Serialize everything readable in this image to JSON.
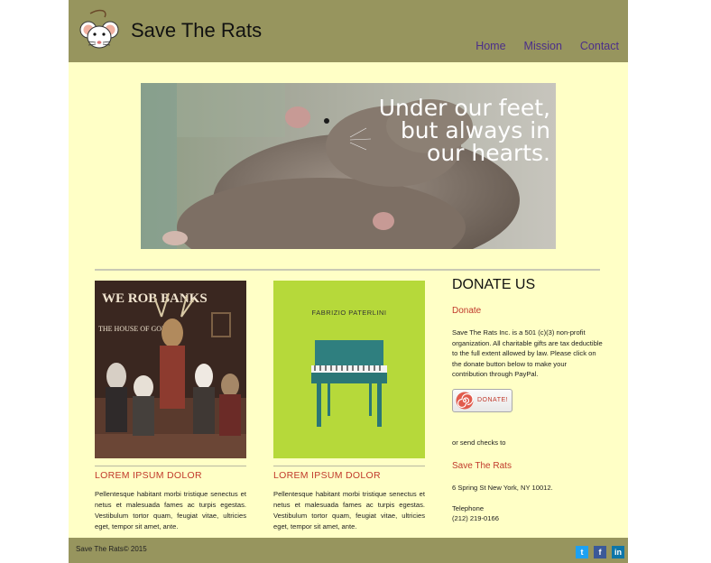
{
  "site": {
    "title": "Save The Rats"
  },
  "nav": {
    "items": [
      "Home",
      "Mission",
      "Contact"
    ]
  },
  "hero": {
    "lines": [
      "Under our feet,",
      "but always in",
      "our hearts."
    ]
  },
  "cards": [
    {
      "art_caption": "WE ROB BANKS",
      "art_sub": "THE HOUSE OF GONZO",
      "title": "LOREM IPSUM DOLOR",
      "text": "Pellentesque habitant morbi tristique senectus et netus et malesuada fames ac turpis egestas. Vestibulum tortor quam, feugiat vitae, ultricies eget, tempor sit amet, ante."
    },
    {
      "art_caption": "FABRIZIO PATERLINI",
      "title": "LOREM IPSUM DOLOR",
      "text": "Pellentesque habitant morbi tristique senectus et netus et malesuada fames ac turpis egestas. Vestibulum tortor quam, feugiat vitae, ultricies eget, tempor sit amet, ante."
    }
  ],
  "donate": {
    "heading": "DONATE US",
    "subheading": "Donate",
    "description": "Save The Rats Inc. is a 501 (c)(3) non-profit organization. All charitable gifts are tax deductible to the full extent allowed by law. Please click on the donate button below to make your contribution through PayPal.",
    "button_label": "DONATE!",
    "checks_text": "or send checks to",
    "org_name": "Save The Rats",
    "address": "6 Spring St New York, NY 10012.",
    "phone_label": "Telephone",
    "phone": "(212) 219-0166"
  },
  "footer": {
    "copyright": "Save The Rats© 2015",
    "social": [
      {
        "name": "twitter",
        "glyph": "t",
        "color": "#1da1f2"
      },
      {
        "name": "facebook",
        "glyph": "f",
        "color": "#3b5998"
      },
      {
        "name": "linkedin",
        "glyph": "in",
        "color": "#0e76a8"
      }
    ]
  },
  "colors": {
    "header": "#97955e",
    "page": "#ffffc6",
    "accent_red": "#c0392b",
    "nav_link": "#4b2e8a"
  }
}
